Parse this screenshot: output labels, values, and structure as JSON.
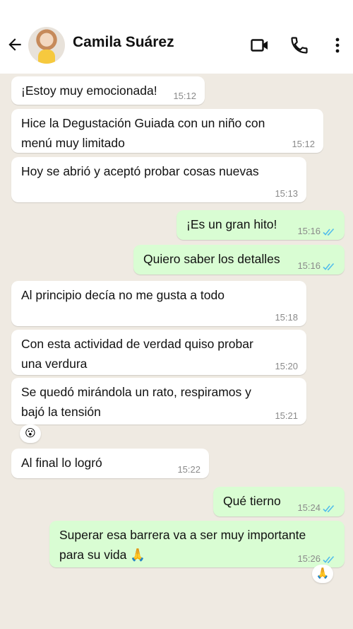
{
  "header": {
    "contact_name": "Camila Suárez",
    "icons": [
      "back-arrow-icon",
      "video-call-icon",
      "phone-icon",
      "more-options-icon"
    ]
  },
  "messages": [
    {
      "dir": "in",
      "text": "¡Estoy muy emocionada!",
      "time": "15:12"
    },
    {
      "dir": "in",
      "text": "Hice la Degustación Guiada con un niño con",
      "text2": "menú muy limitado",
      "time": "15:12"
    },
    {
      "dir": "in",
      "text": "Hoy se abrió y aceptó probar cosas nuevas",
      "time": "15:13"
    },
    {
      "dir": "out",
      "text": "¡Es un gran hito!",
      "time": "15:16",
      "status": "read"
    },
    {
      "dir": "out",
      "text": "Quiero saber los detalles",
      "time": "15:16",
      "status": "read"
    },
    {
      "dir": "in",
      "text": "Al principio decía no me gusta a todo",
      "time": "15:18"
    },
    {
      "dir": "in",
      "text": "Con esta actividad de verdad quiso probar",
      "text2": "una verdura",
      "time": "15:20"
    },
    {
      "dir": "in",
      "text": "Se quedó mirándola un rato, respiramos y",
      "text2": "bajó la tensión",
      "time": "15:21",
      "reaction": "😮"
    },
    {
      "dir": "in",
      "text": "Al final lo logró",
      "time": "15:22"
    },
    {
      "dir": "out",
      "text": "Qué tierno",
      "time": "15:24",
      "status": "read"
    },
    {
      "dir": "out",
      "text": "Superar esa barrera va a ser muy importante",
      "text2": "para su vida 🙏",
      "time": "15:26",
      "status": "read",
      "reaction": "🙏"
    }
  ],
  "colors": {
    "incoming": "#ffffff",
    "outgoing": "#d9fdd3",
    "read_ticks": "#53bdeb",
    "background": "#efeae2"
  }
}
